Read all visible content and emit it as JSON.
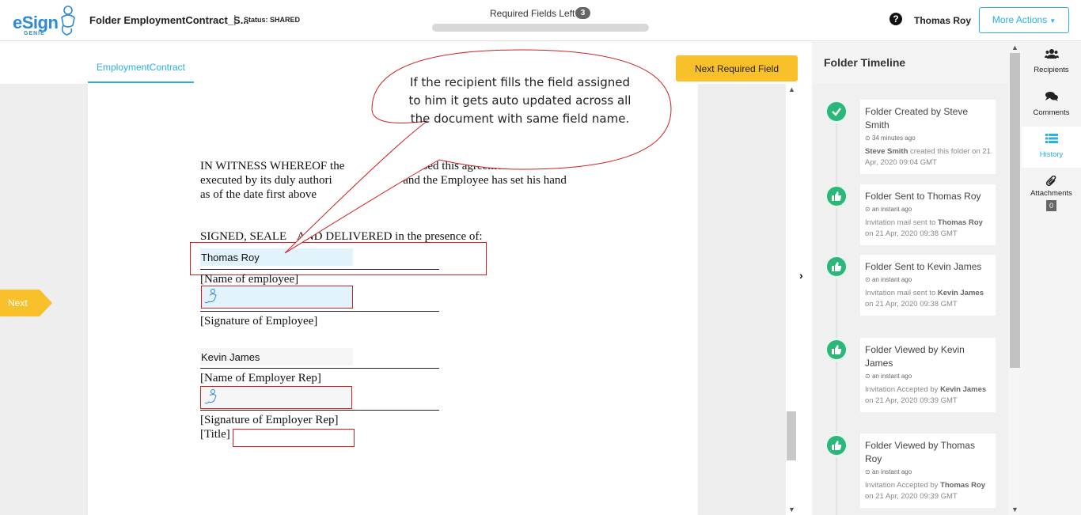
{
  "header": {
    "logo_text": "eSign",
    "logo_sub": "GENIE",
    "folder_title": "Folder EmploymentContract_S...",
    "separator": "|",
    "status": "Status: SHARED",
    "required_label": "Required Fields Left",
    "required_count": "3",
    "user_name": "Thomas Roy",
    "more_actions": "More Actions",
    "help": "?"
  },
  "tabs": [
    {
      "label": "EmploymentContract",
      "active": true
    }
  ],
  "next_required_button": "Next Required Field",
  "next_tag": "Next",
  "callout": {
    "text": "If the recipient fills the field assigned to him it gets auto updated across all the document with same field name."
  },
  "document": {
    "witness_1": "IN WITNESS WHEREOF the",
    "witness_1b": "has caused this agreement to be",
    "witness_2": "executed by its duly authori",
    "witness_2b": "ers and the Employee has set his hand",
    "witness_3": "as of the date first above",
    "signed": "SIGNED, SEALE",
    "signed_b": "AND DELIVERED in the presence of:",
    "employee_name_value": "Thomas Roy",
    "name_of_employee": "[Name of employee]",
    "signature_of_employee": "[Signature of Employee]",
    "employer_name_value": "Kevin James",
    "name_of_employer_rep": "[Name of Employer Rep]",
    "signature_of_employer_rep": "[Signature of Employer Rep]",
    "title_label": "[Title]"
  },
  "timeline": {
    "title": "Folder Timeline",
    "events": [
      {
        "icon": "check-icon",
        "title": "Folder Created by Steve Smith",
        "time": "34 minutes ago",
        "actor": "Steve Smith",
        "desc": "created this folder on 21 Apr, 2020 09:04 GMT"
      },
      {
        "icon": "thumbs-up-icon",
        "title": "Folder Sent to Thomas Roy",
        "time": "an instant ago",
        "pre": "Invitation mail sent to",
        "actor": "Thomas Roy",
        "desc": "on 21 Apr, 2020 09:38 GMT"
      },
      {
        "icon": "thumbs-up-icon",
        "title": "Folder Sent to Kevin James",
        "time": "an instant ago",
        "pre": "Invitation mail sent to",
        "actor": "Kevin James",
        "desc": "on 21 Apr, 2020 09:38 GMT"
      },
      {
        "icon": "thumbs-up-icon",
        "title": "Folder Viewed by Kevin James",
        "time": "an instant ago",
        "pre": "Invitation Accepted by",
        "actor": "Kevin James",
        "desc": "on 21 Apr, 2020 09:39 GMT"
      },
      {
        "icon": "thumbs-up-icon",
        "title": "Folder Viewed by Thomas Roy",
        "time": "an instant ago",
        "pre": "Invitation Accepted by",
        "actor": "Thomas Roy",
        "desc": "on 21 Apr, 2020 09:39 GMT"
      }
    ]
  },
  "rail": [
    {
      "label": "Recipients",
      "icon": "users-icon"
    },
    {
      "label": "Comments",
      "icon": "comments-icon"
    },
    {
      "label": "History",
      "icon": "list-icon",
      "active": true
    },
    {
      "label": "Attachments",
      "icon": "paperclip-icon",
      "count": "0"
    }
  ],
  "colors": {
    "accent": "#29aee6",
    "yellow": "#f8c02b",
    "green": "#2bb77a",
    "required_border": "#d02020",
    "filled_field": "#e3f3fb"
  }
}
